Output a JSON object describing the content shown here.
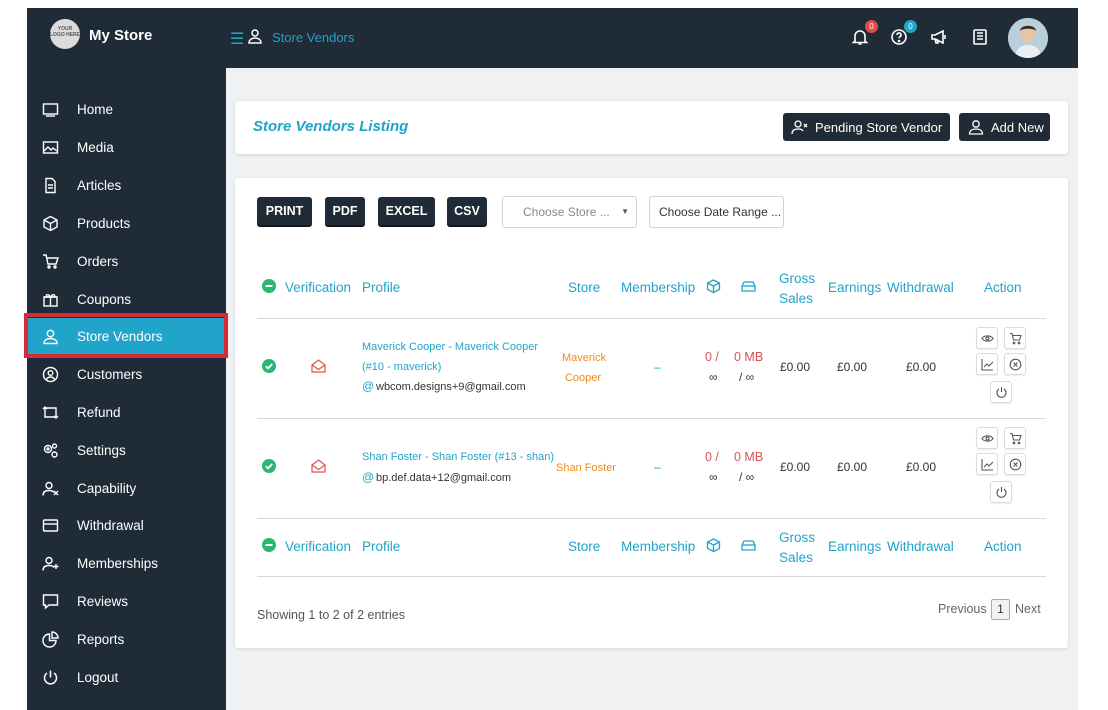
{
  "app": {
    "name": "My Store",
    "logo_text": "YOUR LOGO HERE"
  },
  "header": {
    "breadcrumb": "Store Vendors",
    "notifications_count": "0",
    "help_count": "0"
  },
  "sidebar": {
    "items": [
      {
        "label": "Home",
        "icon": "home-icon"
      },
      {
        "label": "Media",
        "icon": "image-icon"
      },
      {
        "label": "Articles",
        "icon": "document-icon"
      },
      {
        "label": "Products",
        "icon": "box-icon"
      },
      {
        "label": "Orders",
        "icon": "cart-icon"
      },
      {
        "label": "Coupons",
        "icon": "gift-icon"
      },
      {
        "label": "Store Vendors",
        "icon": "user-icon",
        "active": true
      },
      {
        "label": "Customers",
        "icon": "user-circle-icon"
      },
      {
        "label": "Refund",
        "icon": "refund-icon"
      },
      {
        "label": "Settings",
        "icon": "gears-icon"
      },
      {
        "label": "Capability",
        "icon": "user-x-icon"
      },
      {
        "label": "Withdrawal",
        "icon": "card-icon"
      },
      {
        "label": "Memberships",
        "icon": "user-plus-icon"
      },
      {
        "label": "Reviews",
        "icon": "comment-icon"
      },
      {
        "label": "Reports",
        "icon": "pie-chart-icon"
      },
      {
        "label": "Logout",
        "icon": "power-icon"
      }
    ]
  },
  "listing": {
    "title": "Store Vendors Listing",
    "pending_button": "Pending Store Vendor",
    "add_button": "Add New"
  },
  "toolbar": {
    "print": "PRINT",
    "pdf": "PDF",
    "excel": "EXCEL",
    "csv": "CSV",
    "store_placeholder": "Choose Store ...",
    "date_range": "Choose Date Range ..."
  },
  "table": {
    "headers": {
      "verification": "Verification",
      "profile": "Profile",
      "store": "Store",
      "membership": "Membership",
      "gross_1": "Gross",
      "gross_2": "Sales",
      "earnings": "Earnings",
      "withdrawal": "Withdrawal",
      "action": "Action"
    },
    "rows": [
      {
        "name_line1": "Maverick Cooper - Maverick Cooper",
        "name_line2": "(#10 - maverick)",
        "email_at": "@",
        "email": "wbcom.designs+9@gmail.com",
        "store_line1": "Maverick",
        "store_line2": "Cooper",
        "membership": "–",
        "products_1": "0 /",
        "products_2": "∞",
        "disk_1": "0 MB",
        "disk_2": "/ ∞",
        "gross": "£0.00",
        "earnings": "£0.00",
        "withdrawal": "£0.00"
      },
      {
        "name_line1": "Shan Foster - Shan Foster (#13 - shan)",
        "email_at": "@",
        "email": "bp.def.data+12@gmail.com",
        "store_line1": "Shan Foster",
        "membership": "–",
        "products_1": "0 /",
        "products_2": "∞",
        "disk_1": "0 MB",
        "disk_2": "/ ∞",
        "gross": "£0.00",
        "earnings": "£0.00",
        "withdrawal": "£0.00"
      }
    ]
  },
  "footer": {
    "showing": "Showing 1 to 2 of 2 entries",
    "previous": "Previous",
    "page": "1",
    "next": "Next"
  },
  "colors": {
    "accent": "#20a4c9",
    "dark": "#1f2b37",
    "highlight": "#d82a35",
    "store_name": "#f08a1d",
    "quota": "#d9534f"
  }
}
